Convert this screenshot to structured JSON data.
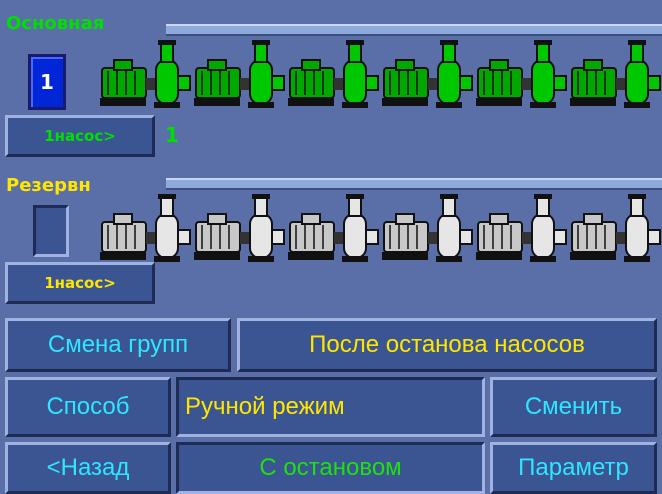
{
  "main_group": {
    "title": "Основная",
    "count": "1",
    "pump_button": "1насос>",
    "pump_number": "1",
    "pump_count": 6,
    "body_color": "#00c800",
    "motor_color": "#00a800"
  },
  "reserve_group": {
    "title": "Резервн",
    "count": "",
    "pump_button": "1насос>",
    "pump_count": 6,
    "body_color": "#e6e6e6",
    "motor_color": "#c8c8c8"
  },
  "group_change": {
    "label": "Смена групп",
    "value": "После останова насосов"
  },
  "method": {
    "label": "Способ",
    "value": "Ручной режим",
    "change_button": "Сменить"
  },
  "footer": {
    "back_button": "<Назад",
    "stop_mode": "С остановом",
    "param_button": "Параметр"
  },
  "colors": {
    "background": "#5a6ea8",
    "main_accent": "#00e000",
    "reserve_accent": "#ffe600",
    "text_cyan": "#2ee6ff"
  }
}
